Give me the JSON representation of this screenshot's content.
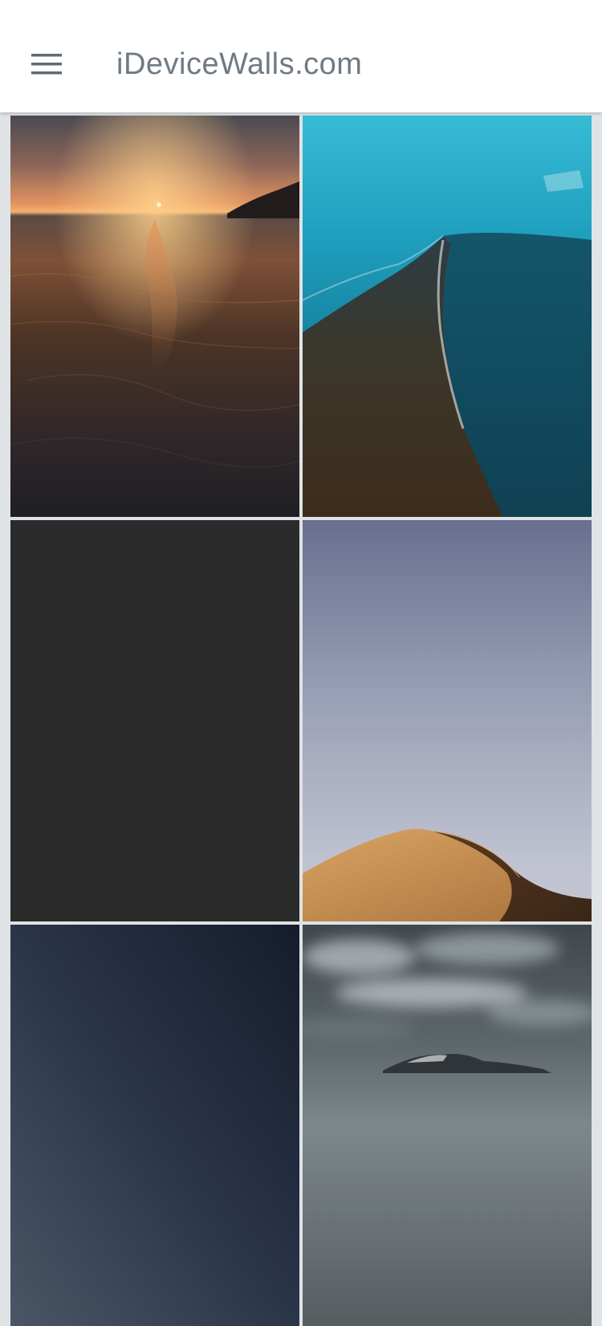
{
  "app_bar": {
    "title": "iDeviceWalls.com",
    "menu_icon": "hamburger-menu-icon",
    "background": "#ffffff",
    "title_color": "#707a83"
  },
  "grid": {
    "background": "#dfe3e6",
    "wallpapers": [
      {
        "name": "wallpaper-sunset-beach",
        "colors": [
          "#e2935f",
          "#5a3a2a",
          "#27211f"
        ]
      },
      {
        "name": "wallpaper-turquoise-coast",
        "colors": [
          "#27b2cf",
          "#0f6f87",
          "#3d2c1c"
        ]
      },
      {
        "name": "wallpaper-dark-gray",
        "colors": [
          "#2b2b2b"
        ]
      },
      {
        "name": "wallpaper-desert-dune",
        "colors": [
          "#69749a",
          "#b9bccb",
          "#c08a4f"
        ]
      },
      {
        "name": "wallpaper-night-sky",
        "colors": [
          "#1a2236",
          "#3b4a5e"
        ]
      },
      {
        "name": "wallpaper-cloudy-mountains",
        "colors": [
          "#4a5257",
          "#9aa2a6",
          "#2f3539"
        ]
      }
    ]
  }
}
